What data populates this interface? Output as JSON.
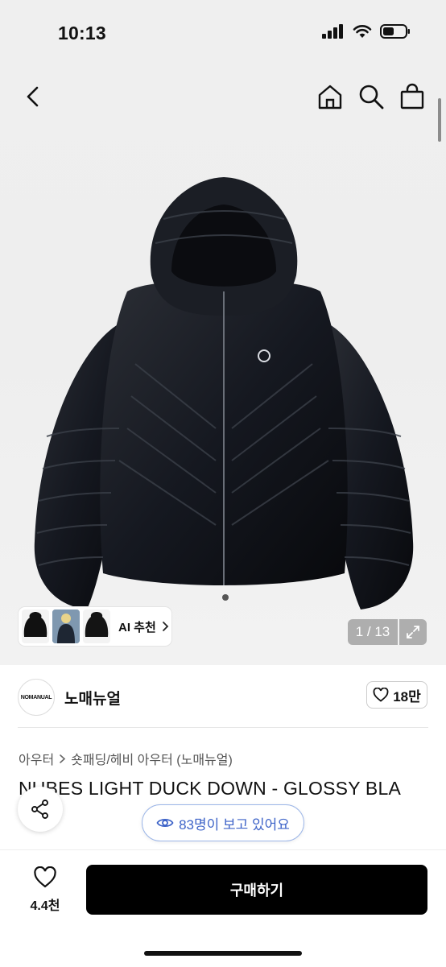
{
  "status_bar": {
    "time": "10:13"
  },
  "nav": {
    "back_icon": "chevron-left-icon",
    "home_icon": "home-icon",
    "search_icon": "search-icon",
    "bag_icon": "shopping-bag-icon"
  },
  "gallery": {
    "ai_recommend_label": "AI 추천",
    "counter": "1 / 13",
    "expand_icon": "expand-icon"
  },
  "shop": {
    "logo_text": "NOMANUAL",
    "name": "노매뉴얼",
    "like_count": "18만"
  },
  "product": {
    "breadcrumb": [
      "아우터",
      "숏패딩/헤비 아우터 (노매뉴얼)"
    ],
    "title": "NUBES LIGHT DUCK DOWN - GLOSSY BLA",
    "viewers": "83명이 보고 있어요"
  },
  "bottom_bar": {
    "wish_count": "4.4천",
    "buy_label": "구매하기"
  },
  "colors": {
    "accent_blue": "#3d63c8",
    "buy_bg": "#000000"
  }
}
